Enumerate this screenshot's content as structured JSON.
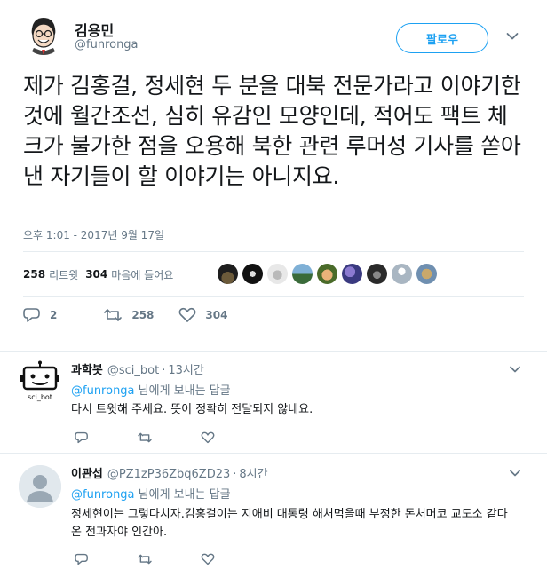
{
  "main_tweet": {
    "author_name": "김용민",
    "author_handle": "@funronga",
    "follow_label": "팔로우",
    "text": "제가 김홍걸, 정세현 두 분을 대북 전문가라고 이야기한 것에 월간조선, 심히 유감인 모양인데, 적어도 팩트 체크가 불가한 점을 오용해 북한 관련 루머성 기사를 쏟아낸 자기들이 할 이야기는 아니지요.",
    "timestamp": "오후 1:01 - 2017년 9월 17일",
    "retweet_count": "258",
    "retweet_label": "리트윗",
    "like_count": "304",
    "like_label": "마음에 들어요",
    "actions": {
      "reply_count": "2",
      "retweet_count": "258",
      "like_count": "304"
    },
    "likers": [
      "liker-1",
      "liker-2",
      "liker-3",
      "liker-4",
      "liker-5",
      "liker-6",
      "liker-7",
      "liker-8",
      "liker-9"
    ]
  },
  "replies": [
    {
      "name": "과학봇",
      "handle": "@sci_bot",
      "time": "13시간",
      "mention": "@funronga",
      "reply_to_suffix": " 님에게 보내는 답글",
      "text": "다시 트윗해 주세요. 뜻이 정확히 전달되지 않네요.",
      "avatar_label": "sci_bot"
    },
    {
      "name": "이관섭",
      "handle": "@PZ1zP36Zbq6ZD23",
      "time": "8시간",
      "mention": "@funronga",
      "reply_to_suffix": " 님에게 보내는 답글",
      "text": "정세현이는 그렇다치자.김홍걸이는 지애비 대통령 해처먹을때 부정한 돈처머코 교도소 같다온 전과자야 인간아."
    }
  ],
  "colors": {
    "accent": "#1da1f2",
    "muted": "#657786",
    "text": "#14171a",
    "border": "#e6ecf0"
  }
}
